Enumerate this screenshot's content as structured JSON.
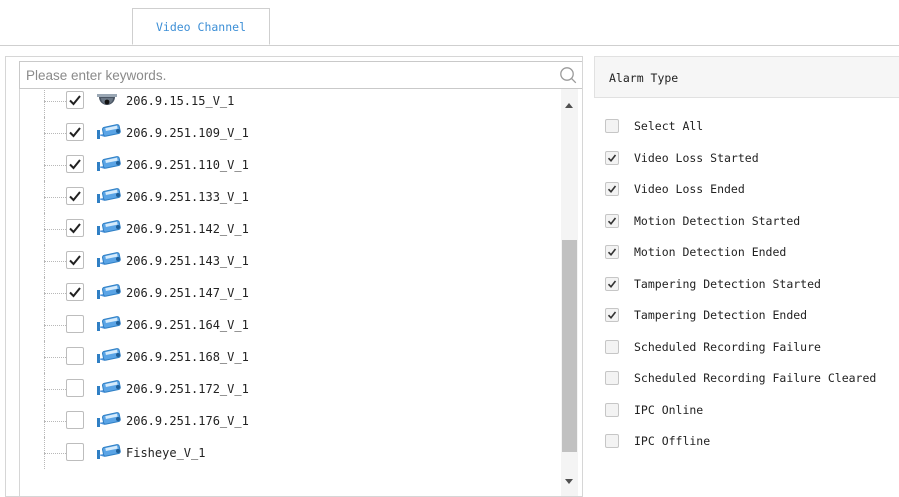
{
  "tabs": {
    "video_channel": "Video Channel"
  },
  "search": {
    "placeholder": "Please enter keywords."
  },
  "channels": [
    {
      "label": "206.9.15.15_V_1",
      "checked": true,
      "icon": "dome-camera-icon"
    },
    {
      "label": "206.9.251.109_V_1",
      "checked": true,
      "icon": "bullet-camera-icon"
    },
    {
      "label": "206.9.251.110_V_1",
      "checked": true,
      "icon": "bullet-camera-icon"
    },
    {
      "label": "206.9.251.133_V_1",
      "checked": true,
      "icon": "bullet-camera-icon"
    },
    {
      "label": "206.9.251.142_V_1",
      "checked": true,
      "icon": "bullet-camera-icon"
    },
    {
      "label": "206.9.251.143_V_1",
      "checked": true,
      "icon": "bullet-camera-icon"
    },
    {
      "label": "206.9.251.147_V_1",
      "checked": true,
      "icon": "bullet-camera-icon"
    },
    {
      "label": "206.9.251.164_V_1",
      "checked": false,
      "icon": "bullet-camera-icon"
    },
    {
      "label": "206.9.251.168_V_1",
      "checked": false,
      "icon": "bullet-camera-icon"
    },
    {
      "label": "206.9.251.172_V_1",
      "checked": false,
      "icon": "bullet-camera-icon"
    },
    {
      "label": "206.9.251.176_V_1",
      "checked": false,
      "icon": "bullet-camera-icon"
    },
    {
      "label": "Fisheye_V_1",
      "checked": false,
      "icon": "bullet-camera-icon"
    }
  ],
  "alarm": {
    "header": "Alarm Type",
    "items": [
      {
        "label": "Select All",
        "checked": false
      },
      {
        "label": "Video Loss Started",
        "checked": true
      },
      {
        "label": "Video Loss Ended",
        "checked": true
      },
      {
        "label": "Motion Detection Started",
        "checked": true
      },
      {
        "label": "Motion Detection Ended",
        "checked": true
      },
      {
        "label": "Tampering Detection Started",
        "checked": true
      },
      {
        "label": "Tampering Detection Ended",
        "checked": true
      },
      {
        "label": "Scheduled Recording Failure",
        "checked": false
      },
      {
        "label": "Scheduled Recording Failure Cleared",
        "checked": false
      },
      {
        "label": "IPC Online",
        "checked": false
      },
      {
        "label": "IPC Offline",
        "checked": false
      }
    ]
  },
  "colors": {
    "tab_text": "#3d8fd6",
    "border": "#cfcfcf",
    "scroll_thumb": "#c1c1c1",
    "header_bg": "#f6f6f6"
  }
}
